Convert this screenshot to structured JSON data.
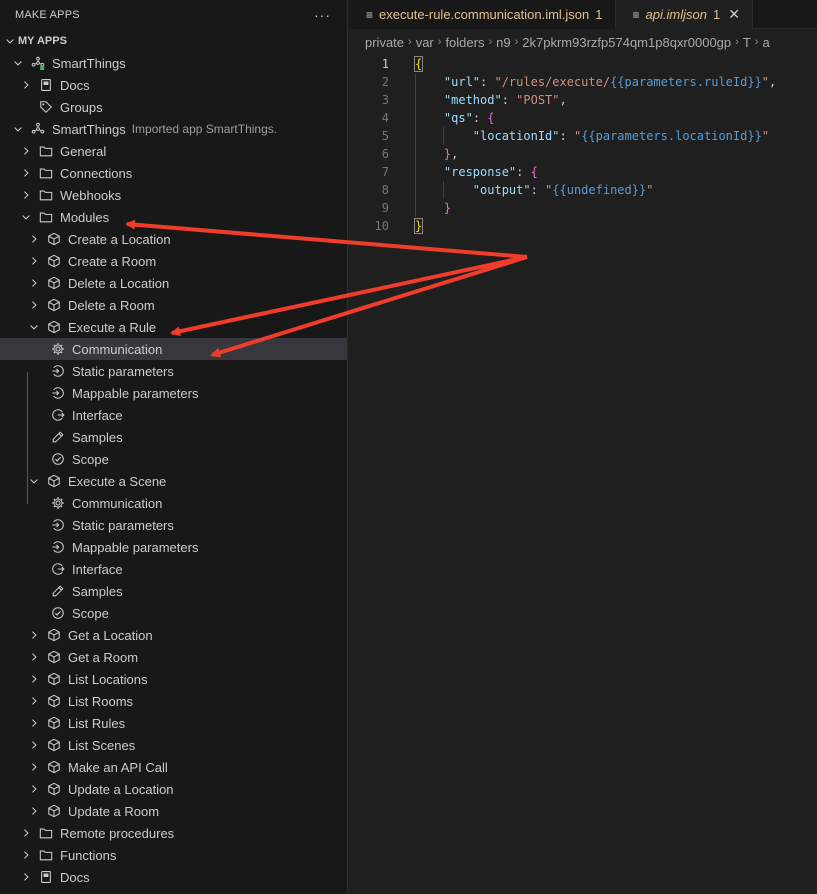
{
  "sidebar": {
    "title": "MAKE APPS",
    "more": "···",
    "items": [
      {
        "label": "MY APPS",
        "desc": "",
        "indent": 0,
        "chev": "down",
        "icon": "",
        "bold": true
      },
      {
        "label": "SmartThings",
        "desc": "",
        "indent": 1,
        "chev": "down",
        "icon": "app-hub",
        "bold": false
      },
      {
        "label": "Docs",
        "desc": "",
        "indent": 2,
        "chev": "right",
        "icon": "book",
        "bold": false
      },
      {
        "label": "Groups",
        "desc": "",
        "indent": 2,
        "chev": "",
        "icon": "tag",
        "bold": false
      },
      {
        "label": "SmartThings",
        "desc": "Imported app SmartThings.",
        "indent": 1,
        "chev": "down",
        "icon": "app-hub-gray",
        "bold": false
      },
      {
        "label": "General",
        "desc": "",
        "indent": 2,
        "chev": "right",
        "icon": "folder",
        "bold": false
      },
      {
        "label": "Connections",
        "desc": "",
        "indent": 2,
        "chev": "right",
        "icon": "folder",
        "bold": false
      },
      {
        "label": "Webhooks",
        "desc": "",
        "indent": 2,
        "chev": "right",
        "icon": "folder",
        "bold": false
      },
      {
        "label": "Modules",
        "desc": "",
        "indent": 2,
        "chev": "down",
        "icon": "folder",
        "bold": false
      },
      {
        "label": "Create a Location",
        "desc": "",
        "indent": 3,
        "chev": "right",
        "icon": "cube",
        "bold": false
      },
      {
        "label": "Create a Room",
        "desc": "",
        "indent": 3,
        "chev": "right",
        "icon": "cube",
        "bold": false
      },
      {
        "label": "Delete a Location",
        "desc": "",
        "indent": 3,
        "chev": "right",
        "icon": "cube",
        "bold": false
      },
      {
        "label": "Delete a Room",
        "desc": "",
        "indent": 3,
        "chev": "right",
        "icon": "cube",
        "bold": false
      },
      {
        "label": "Execute a Rule",
        "desc": "",
        "indent": 3,
        "chev": "down",
        "icon": "cube",
        "bold": false
      },
      {
        "label": "Communication",
        "desc": "",
        "indent": 4,
        "chev": "",
        "icon": "gear",
        "bold": false,
        "selected": true
      },
      {
        "label": "Static parameters",
        "desc": "",
        "indent": 4,
        "chev": "",
        "icon": "arrow-circle",
        "bold": false
      },
      {
        "label": "Mappable parameters",
        "desc": "",
        "indent": 4,
        "chev": "",
        "icon": "arrow-circle",
        "bold": false
      },
      {
        "label": "Interface",
        "desc": "",
        "indent": 4,
        "chev": "",
        "icon": "arrow-out-circle",
        "bold": false
      },
      {
        "label": "Samples",
        "desc": "",
        "indent": 4,
        "chev": "",
        "icon": "pipette",
        "bold": false
      },
      {
        "label": "Scope",
        "desc": "",
        "indent": 4,
        "chev": "",
        "icon": "check-circle",
        "bold": false
      },
      {
        "label": "Execute a Scene",
        "desc": "",
        "indent": 3,
        "chev": "down",
        "icon": "cube",
        "bold": false
      },
      {
        "label": "Communication",
        "desc": "",
        "indent": 4,
        "chev": "",
        "icon": "gear",
        "bold": false
      },
      {
        "label": "Static parameters",
        "desc": "",
        "indent": 4,
        "chev": "",
        "icon": "arrow-circle",
        "bold": false
      },
      {
        "label": "Mappable parameters",
        "desc": "",
        "indent": 4,
        "chev": "",
        "icon": "arrow-circle",
        "bold": false
      },
      {
        "label": "Interface",
        "desc": "",
        "indent": 4,
        "chev": "",
        "icon": "arrow-out-circle",
        "bold": false
      },
      {
        "label": "Samples",
        "desc": "",
        "indent": 4,
        "chev": "",
        "icon": "pipette",
        "bold": false
      },
      {
        "label": "Scope",
        "desc": "",
        "indent": 4,
        "chev": "",
        "icon": "check-circle",
        "bold": false
      },
      {
        "label": "Get a Location",
        "desc": "",
        "indent": 3,
        "chev": "right",
        "icon": "cube",
        "bold": false
      },
      {
        "label": "Get a Room",
        "desc": "",
        "indent": 3,
        "chev": "right",
        "icon": "cube",
        "bold": false
      },
      {
        "label": "List Locations",
        "desc": "",
        "indent": 3,
        "chev": "right",
        "icon": "cube",
        "bold": false
      },
      {
        "label": "List Rooms",
        "desc": "",
        "indent": 3,
        "chev": "right",
        "icon": "cube",
        "bold": false
      },
      {
        "label": "List Rules",
        "desc": "",
        "indent": 3,
        "chev": "right",
        "icon": "cube",
        "bold": false
      },
      {
        "label": "List Scenes",
        "desc": "",
        "indent": 3,
        "chev": "right",
        "icon": "cube",
        "bold": false
      },
      {
        "label": "Make an API Call",
        "desc": "",
        "indent": 3,
        "chev": "right",
        "icon": "cube",
        "bold": false
      },
      {
        "label": "Update a Location",
        "desc": "",
        "indent": 3,
        "chev": "right",
        "icon": "cube",
        "bold": false
      },
      {
        "label": "Update a Room",
        "desc": "",
        "indent": 3,
        "chev": "right",
        "icon": "cube",
        "bold": false
      },
      {
        "label": "Remote procedures",
        "desc": "",
        "indent": 2,
        "chev": "right",
        "icon": "folder",
        "bold": false
      },
      {
        "label": "Functions",
        "desc": "",
        "indent": 2,
        "chev": "right",
        "icon": "folder",
        "bold": false
      },
      {
        "label": "Docs",
        "desc": "",
        "indent": 2,
        "chev": "right",
        "icon": "book",
        "bold": false
      }
    ]
  },
  "editor": {
    "tabs": [
      {
        "label": "execute-rule.communication.iml.json",
        "badge": "1",
        "active": false
      },
      {
        "label": "api.imljson",
        "badge": "1",
        "active": true,
        "close": "✕"
      }
    ],
    "breadcrumb": [
      "private",
      "var",
      "folders",
      "n9",
      "2k7pkrm93rzfp574qm1p8qxr0000gp",
      "T",
      "a"
    ],
    "code_lines": [
      {
        "n": "1"
      },
      {
        "n": "2"
      },
      {
        "n": "3"
      },
      {
        "n": "4"
      },
      {
        "n": "5"
      },
      {
        "n": "6"
      },
      {
        "n": "7"
      },
      {
        "n": "8"
      },
      {
        "n": "9"
      },
      {
        "n": "10"
      }
    ],
    "code": {
      "k_url": "\"url\"",
      "v_url_a": "\"/rules/execute/",
      "v_url_t": "{{parameters.ruleId}}",
      "v_url_b": "\"",
      "k_method": "\"method\"",
      "v_method": "\"POST\"",
      "k_qs": "\"qs\"",
      "k_location": "\"locationId\"",
      "v_location_t": "{{parameters.locationId}}",
      "k_response": "\"response\"",
      "k_output": "\"output\"",
      "v_output_t": "{{undefined}}"
    }
  },
  "colors": {
    "accent_arrow": "#f03c2a",
    "modified_tab": "#e2c08d",
    "selected_row": "#37373d",
    "smartthings_dot": "#3fb950"
  }
}
